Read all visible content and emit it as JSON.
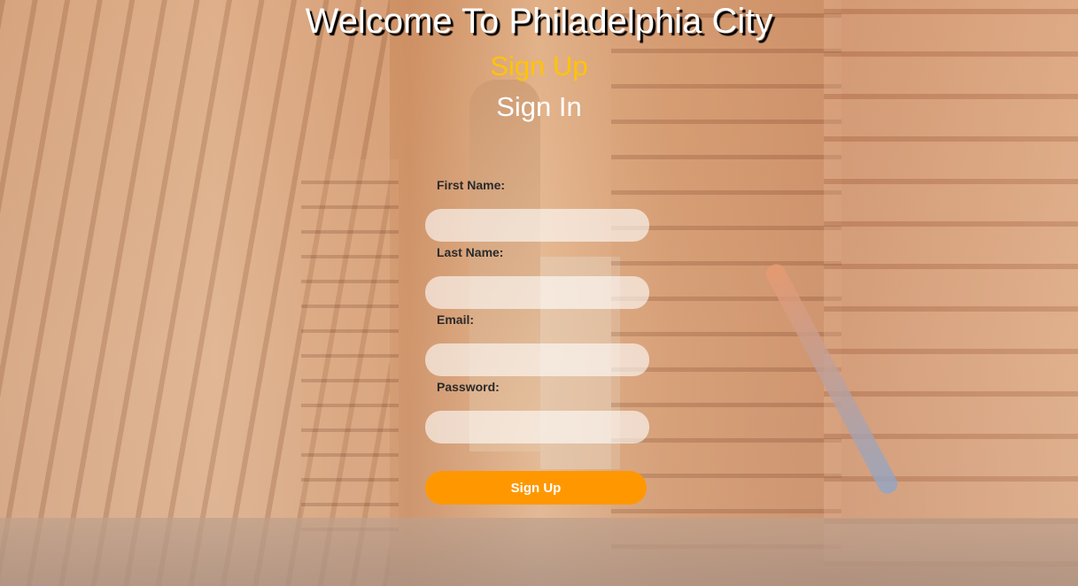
{
  "header": {
    "title": "Welcome To Philadelphia City"
  },
  "nav": {
    "signup_link": "Sign Up",
    "signin_link": "Sign In"
  },
  "form": {
    "first_name_label": "First Name:",
    "last_name_label": "Last Name:",
    "email_label": "Email:",
    "password_label": "Password:",
    "first_name_value": "",
    "last_name_value": "",
    "email_value": "",
    "password_value": "",
    "submit_label": "Sign Up"
  },
  "colors": {
    "accent": "#ff9800",
    "active_nav": "#ffc400",
    "title": "#ffffff"
  }
}
